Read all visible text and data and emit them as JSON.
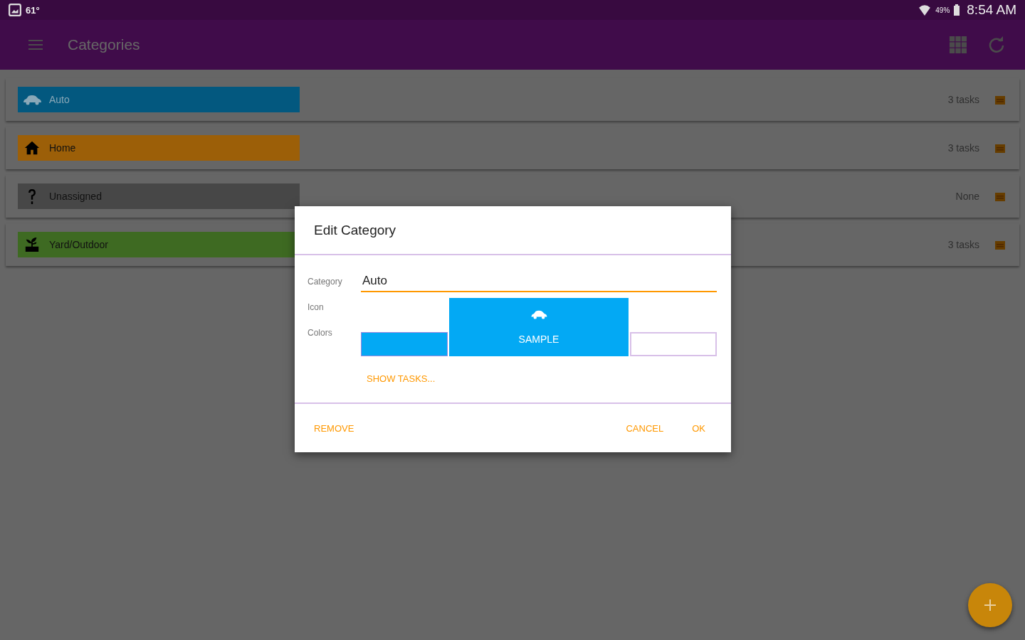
{
  "status_bar": {
    "temperature": "61°",
    "battery": "49%",
    "time": "8:54 AM"
  },
  "app_bar": {
    "title": "Categories"
  },
  "categories": [
    {
      "name": "Auto",
      "kind": "car",
      "color": "#03587f",
      "count": "3 tasks"
    },
    {
      "name": "Home",
      "kind": "home",
      "color": "#9c5f08",
      "count": "3 tasks"
    },
    {
      "name": "Unassigned",
      "kind": "question",
      "color": "#474747",
      "count": "None"
    },
    {
      "name": "Yard/Outdoor",
      "kind": "plant",
      "color": "#3e6a22",
      "count": "3 tasks"
    }
  ],
  "dialog": {
    "title": "Edit Category",
    "fields": [
      {
        "label": "Category",
        "value": "Auto"
      },
      {
        "label": "Icon"
      },
      {
        "label": "Colors"
      }
    ],
    "colors": [
      {
        "color": "#03a9f4"
      },
      {
        "color": "#ffffff"
      }
    ],
    "sample": {
      "label": "SAMPLE",
      "kind": "car",
      "color": "#03a9f4"
    },
    "show_tasks": "SHOW TASKS...",
    "buttons": [
      {
        "label": "REMOVE",
        "kind": "left"
      },
      {
        "label": "CANCEL",
        "kind": "right"
      },
      {
        "label": "OK",
        "kind": "right"
      }
    ]
  }
}
